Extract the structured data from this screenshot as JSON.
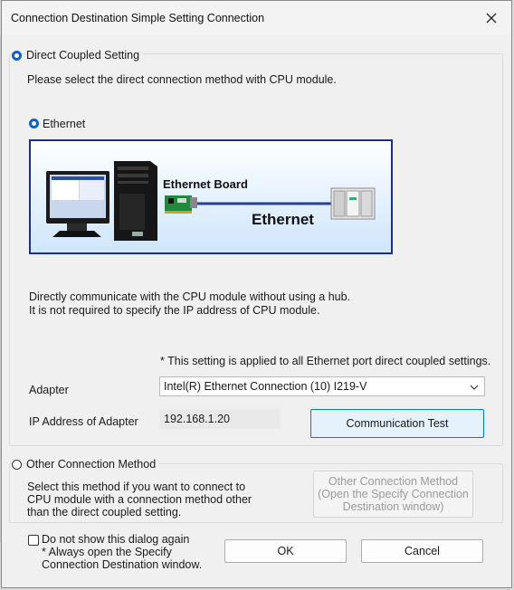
{
  "window": {
    "title": "Connection Destination Simple Setting Connection",
    "close_icon": "close-icon"
  },
  "direct": {
    "radio_label": "Direct Coupled Setting",
    "prompt": "Please select the direct connection method with CPU module.",
    "ethernet_label": "Ethernet",
    "diagram": {
      "board_label": "Ethernet Board",
      "line_label": "Ethernet"
    },
    "desc_line1": "Directly communicate with the CPU module without using a hub.",
    "desc_line2": "It is not required to specify the IP address of CPU module.",
    "note": "* This setting is applied to all Ethernet port direct coupled settings.",
    "adapter_label": "Adapter",
    "adapter_value": "Intel(R) Ethernet Connection (10) I219-V",
    "ip_label": "IP Address of Adapter",
    "ip_value": "192.168.1.20",
    "test_button": "Communication Test"
  },
  "other": {
    "radio_label": "Other Connection Method",
    "desc_line1": "Select this method if you want to connect to",
    "desc_line2": "CPU module with a connection method other",
    "desc_line3": "than the direct coupled setting.",
    "button_line1": "Other Connection Method",
    "button_line2": "(Open the Specify Connection",
    "button_line3": "Destination window)"
  },
  "footer": {
    "checkbox_label": "Do not show this dialog again",
    "note_line1": "* Always open the Specify",
    "note_line2": "Connection Destination window.",
    "ok_button": "OK",
    "cancel_button": "Cancel"
  },
  "colors": {
    "radio_selected": "#1160c8",
    "diagram_border": "#1d2d8c",
    "accent_button": "#e5f1fb"
  }
}
